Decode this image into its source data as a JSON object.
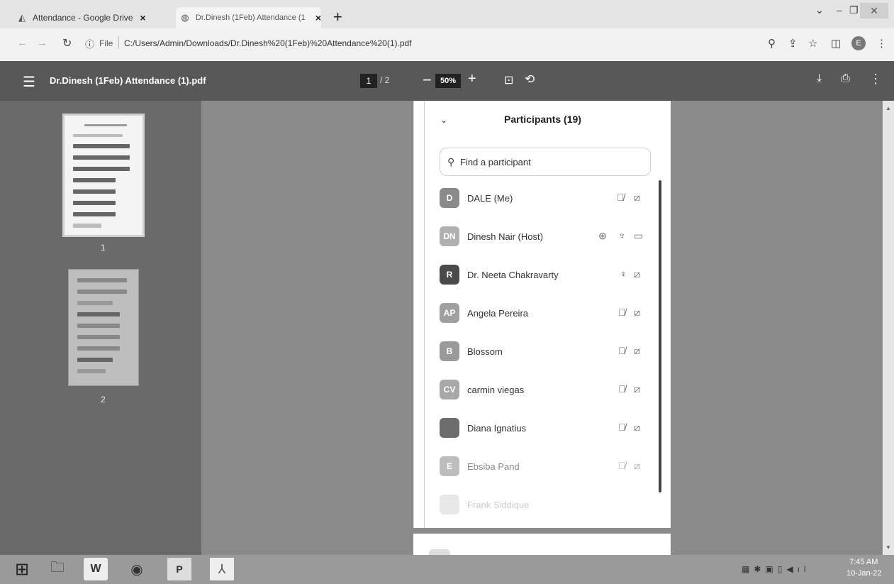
{
  "browser": {
    "tabs": [
      {
        "title": "Attendance - Google Drive",
        "close": "×",
        "icon": "google-drive-icon"
      },
      {
        "title": "Dr.Dinesh (1Feb) Attendance (1",
        "close": "×",
        "icon": "globe-icon"
      }
    ],
    "new_tab": "+",
    "url_label": "File",
    "url": "C:/Users/Admin/Downloads/Dr.Dinesh%20(1Feb)%20Attendance%20(1).pdf",
    "profile_initial": "E"
  },
  "pdf_toolbar": {
    "title": "Dr.Dinesh (1Feb) Attendance (1).pdf",
    "current_page": "1",
    "total_pages": "/ 2",
    "zoom": "50%",
    "zoom_minus": "−",
    "zoom_plus": "+"
  },
  "thumbnails": [
    {
      "label": "1"
    },
    {
      "label": "2"
    }
  ],
  "panel": {
    "title": "Participants (19)",
    "search_placeholder": "Find a participant",
    "participants": [
      {
        "initials": "D",
        "name": "DALE (Me)",
        "color": "#8a8a8a"
      },
      {
        "initials": "DN",
        "name": "Dinesh Nair (Host)",
        "color": "#b0b0b0"
      },
      {
        "initials": "R",
        "name": "Dr. Neeta Chakravarty",
        "color": "#4a4a4a"
      },
      {
        "initials": "AP",
        "name": "Angela Pereira",
        "color": "#a0a0a0"
      },
      {
        "initials": "B",
        "name": "Blossom",
        "color": "#9a9a9a"
      },
      {
        "initials": "CV",
        "name": "carmin viegas",
        "color": "#a8a8a8"
      },
      {
        "initials": "",
        "name": "Diana Ignatius",
        "color": "#7a6a6a"
      },
      {
        "initials": "E",
        "name": "Ebsiba Pand",
        "color": "#bdbdbd"
      },
      {
        "initials": "",
        "name": "Frank Siddique",
        "color": "#e8e8e8"
      }
    ]
  },
  "taskbar": {
    "word": "W",
    "publisher": "P",
    "time": "7:45 AM",
    "date": "10-Jan-22"
  }
}
